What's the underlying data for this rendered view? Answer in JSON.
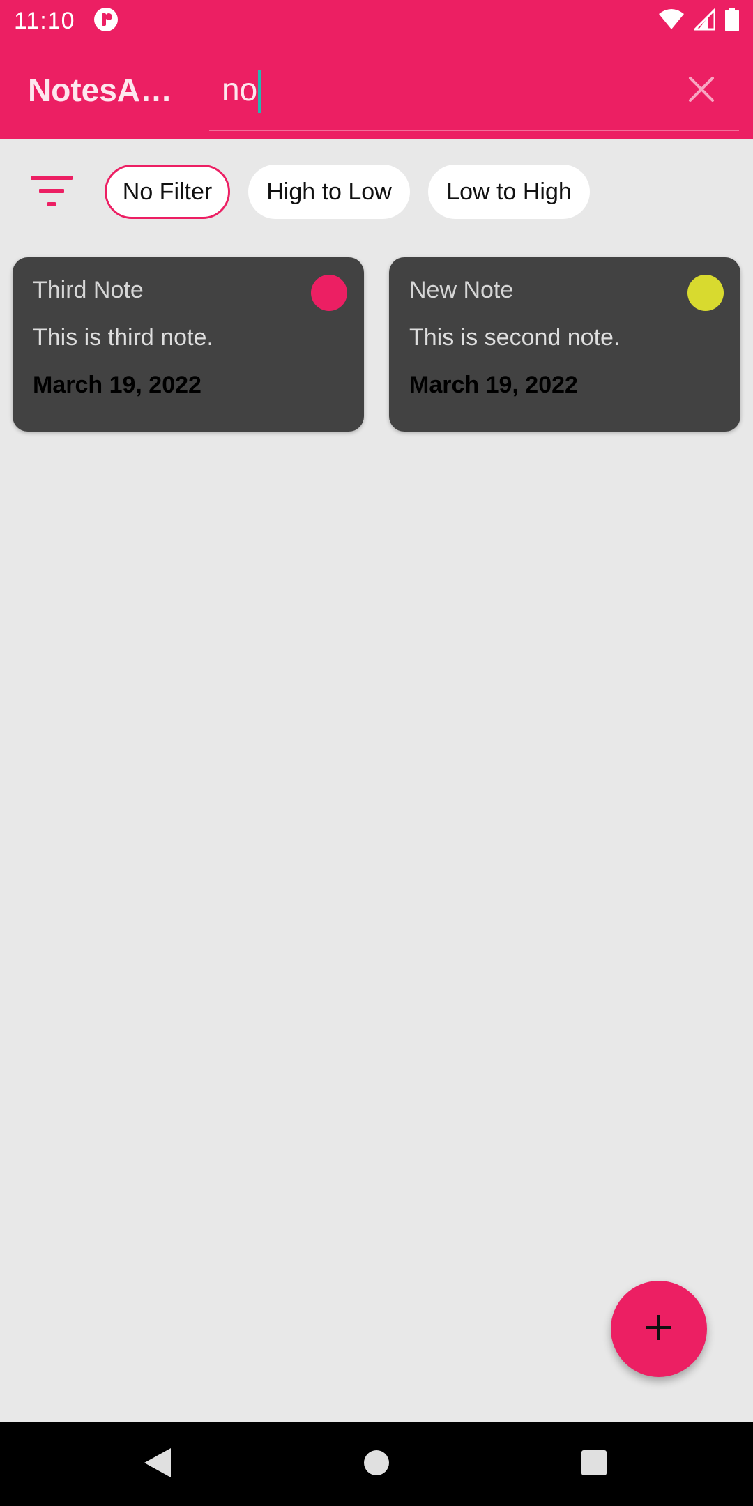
{
  "status_bar": {
    "time": "11:10",
    "icons": [
      "app-notification-icon",
      "wifi-icon",
      "signal-icon",
      "battery-icon"
    ]
  },
  "app_bar": {
    "title": "NotesA…",
    "search": {
      "value": "no",
      "placeholder": ""
    },
    "clear_icon": "close-icon"
  },
  "filters": {
    "icon": "filter-icon",
    "chips": [
      {
        "label": "No Filter",
        "selected": true
      },
      {
        "label": "High to Low",
        "selected": false
      },
      {
        "label": "Low to High",
        "selected": false
      }
    ]
  },
  "notes": [
    {
      "title": "Third Note",
      "body": "This is third note.",
      "date": "March 19, 2022",
      "priority_color": "#ec1f63"
    },
    {
      "title": "New Note",
      "body": "This is second note.",
      "date": "March 19, 2022",
      "priority_color": "#d8da2f"
    }
  ],
  "fab": {
    "icon": "plus-icon"
  },
  "navigation": {
    "icons": [
      "back-icon",
      "home-icon",
      "recents-icon"
    ]
  },
  "colors": {
    "primary": "#ec1f63",
    "background": "#e8e8e8",
    "card": "#424242",
    "accent_cursor": "#26b7b0"
  }
}
